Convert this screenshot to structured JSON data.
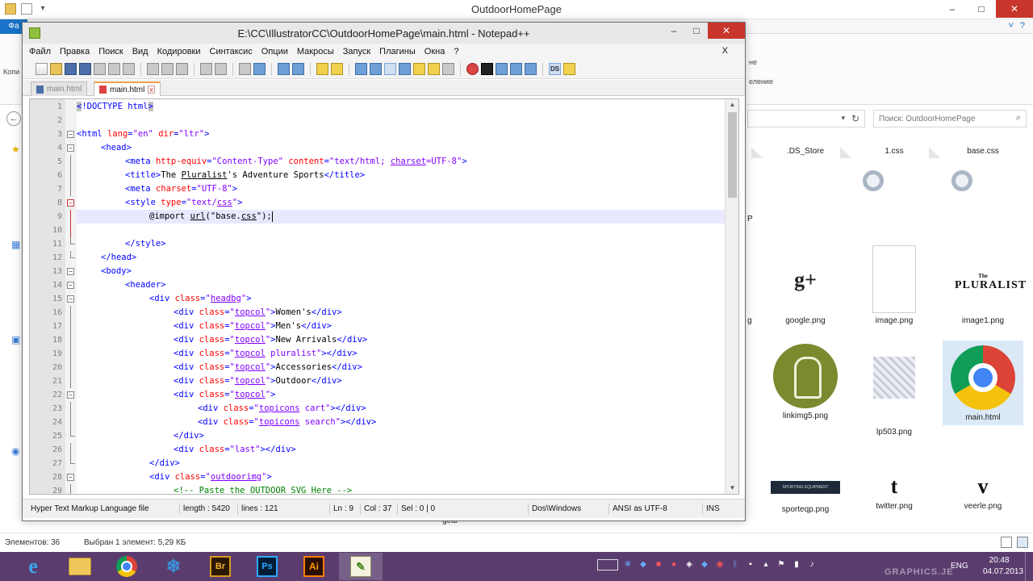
{
  "explorer": {
    "window_title": "OutdoorHomePage",
    "ribbon_file_tab": "Фа",
    "ribbon_left_label": "Копи",
    "ribbon_right_labels": [
      "не",
      "еление"
    ],
    "search_placeholder": "Поиск: OutdoorHomePage",
    "files": [
      {
        "name": ".DS_Store",
        "kind": "doc"
      },
      {
        "name": "1.css",
        "kind": "css"
      },
      {
        "name": "base.css",
        "kind": "css"
      },
      {
        "name": "google.png",
        "kind": "gplus"
      },
      {
        "name": "image.png",
        "kind": "blank"
      },
      {
        "name": "image1.png",
        "kind": "pluralist"
      },
      {
        "name": "linkimg5.png",
        "kind": "green"
      },
      {
        "name": "lp503.png",
        "kind": "stripes"
      },
      {
        "name": "main.html",
        "kind": "chrome"
      },
      {
        "name": "sporteqp.png",
        "kind": "banner"
      },
      {
        "name": "twitter.png",
        "kind": "twitter"
      },
      {
        "name": "veerle.png",
        "kind": "veerle"
      }
    ],
    "partial_labels": {
      "left_col_1": "P",
      "left_col_2": "g",
      "below_window": "gear"
    },
    "status_count": "Элементов: 36",
    "status_selected": "Выбран 1 элемент: 5,29 КБ",
    "pluralist_small": "The",
    "pluralist_big": "PLURALIST",
    "banner_text": "SPORTING EQUIPMENT"
  },
  "npp": {
    "title": "E:\\CC\\IllustratorCC\\OutdoorHomePage\\main.html - Notepad++",
    "menu": [
      "Файл",
      "Правка",
      "Поиск",
      "Вид",
      "Кодировки",
      "Синтаксис",
      "Опции",
      "Макросы",
      "Запуск",
      "Плагины",
      "Окна",
      "?"
    ],
    "menu_close": "X",
    "tabs": [
      {
        "label": "main.html",
        "active": false
      },
      {
        "label": "main.html",
        "active": true
      }
    ],
    "lines": [
      {
        "n": "1",
        "indent": 0
      },
      {
        "n": "2",
        "indent": 0
      },
      {
        "n": "3",
        "indent": 0
      },
      {
        "n": "4",
        "indent": 1
      },
      {
        "n": "5",
        "indent": 2
      },
      {
        "n": "6",
        "indent": 2
      },
      {
        "n": "7",
        "indent": 2
      },
      {
        "n": "8",
        "indent": 2
      },
      {
        "n": "9",
        "indent": 3
      },
      {
        "n": "10",
        "indent": 0
      },
      {
        "n": "11",
        "indent": 2
      },
      {
        "n": "12",
        "indent": 1
      },
      {
        "n": "13",
        "indent": 1
      },
      {
        "n": "14",
        "indent": 2
      },
      {
        "n": "15",
        "indent": 3
      },
      {
        "n": "16",
        "indent": 4
      },
      {
        "n": "17",
        "indent": 4
      },
      {
        "n": "18",
        "indent": 4
      },
      {
        "n": "19",
        "indent": 4
      },
      {
        "n": "20",
        "indent": 4
      },
      {
        "n": "21",
        "indent": 4
      },
      {
        "n": "22",
        "indent": 4
      },
      {
        "n": "23",
        "indent": 5
      },
      {
        "n": "24",
        "indent": 5
      },
      {
        "n": "25",
        "indent": 4
      },
      {
        "n": "26",
        "indent": 4
      },
      {
        "n": "27",
        "indent": 3
      },
      {
        "n": "28",
        "indent": 3
      },
      {
        "n": "29",
        "indent": 4
      }
    ],
    "code": {
      "l1": [
        "<",
        "!DOCTYPE html",
        ">"
      ],
      "l3": [
        "<html ",
        "lang",
        "=",
        "\"en\"",
        " ",
        "dir",
        "=",
        "\"ltr\"",
        ">"
      ],
      "l4": [
        "<head>"
      ],
      "l5": [
        "<meta ",
        "http-equiv",
        "=",
        "\"Content-Type\"",
        " ",
        "content",
        "=",
        "\"text/html; ",
        "charset",
        "=UTF-8\"",
        ">"
      ],
      "l6": [
        "<title>",
        "The ",
        "Pluralist",
        "'s Adventure Sports",
        "</title>"
      ],
      "l7": [
        "<meta ",
        "charset",
        "=",
        "\"UTF-8\"",
        ">"
      ],
      "l8": [
        "<style ",
        "type",
        "=",
        "\"text/",
        "css",
        "\"",
        ">"
      ],
      "l9": [
        "@import ",
        "url",
        "(\"base.",
        "css",
        "\");"
      ],
      "l11": [
        "</style>"
      ],
      "l12": [
        "</head>"
      ],
      "l13": [
        "<body>"
      ],
      "l14": [
        "<header>"
      ],
      "l15": [
        "<div ",
        "class",
        "=",
        "\"",
        "headbg",
        "\"",
        ">"
      ],
      "l16": [
        "<div ",
        "class",
        "=",
        "\"",
        "topcol",
        "\"",
        ">",
        "Women's",
        "</div>"
      ],
      "l17": [
        "<div ",
        "class",
        "=",
        "\"",
        "topcol",
        "\"",
        ">",
        "Men's",
        "</div>"
      ],
      "l18": [
        "<div ",
        "class",
        "=",
        "\"",
        "topcol",
        "\"",
        ">",
        "New Arrivals",
        "</div>"
      ],
      "l19": [
        "<div ",
        "class",
        "=",
        "\"",
        "topcol",
        " pluralist\"",
        "></div>"
      ],
      "l20": [
        "<div ",
        "class",
        "=",
        "\"",
        "topcol",
        "\"",
        ">",
        "Accessories",
        "</div>"
      ],
      "l21": [
        "<div ",
        "class",
        "=",
        "\"",
        "topcol",
        "\"",
        ">",
        "Outdoor",
        "</div>"
      ],
      "l22": [
        "<div ",
        "class",
        "=",
        "\"",
        "topcol",
        "\"",
        ">"
      ],
      "l23": [
        "<div ",
        "class",
        "=",
        "\"",
        "topicons",
        " cart\"",
        "></div>"
      ],
      "l24": [
        "<div ",
        "class",
        "=",
        "\"",
        "topicons",
        " search\"",
        "></div>"
      ],
      "l25": [
        "</div>"
      ],
      "l26": [
        "<div ",
        "class",
        "=",
        "\"last\"",
        "></div>"
      ],
      "l27": [
        "</div>"
      ],
      "l28": [
        "<div ",
        "class",
        "=",
        "\"",
        "outdoorimg",
        "\"",
        ">"
      ],
      "l29": [
        "<!-- Paste the OUTDOOR SVG Here -->"
      ]
    },
    "status": {
      "type": "Hyper Text Markup Language file",
      "length": "length : 5420",
      "lines": "lines : 121",
      "ln": "Ln : 9",
      "col": "Col : 37",
      "sel": "Sel : 0 | 0",
      "eol": "Dos\\Windows",
      "encoding": "ANSI as UTF-8",
      "mode": "INS"
    }
  },
  "taskbar": {
    "lang": "ENG",
    "time": "20:48",
    "date": "04.07.2013",
    "apps": [
      "Internet Explorer",
      "File Explorer",
      "Chrome",
      "Snowflake app",
      "Bridge",
      "Photoshop",
      "Illustrator",
      "Notepad++"
    ],
    "app_labels": {
      "ie": "e",
      "br": "Br",
      "ps": "Ps",
      "ai": "Ai",
      "npp": "✎"
    },
    "watermark": "GRAPHICS.JE"
  },
  "colors": {
    "taskbar": "#5a3d6e",
    "tag": "#0000ff",
    "attr": "#ff0000",
    "value": "#8000ff",
    "comment": "#008000",
    "current_line": "#e8e8ff"
  }
}
